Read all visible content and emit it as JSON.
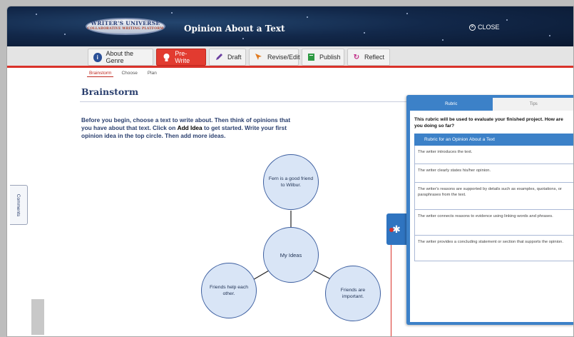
{
  "header": {
    "logo_text": "WRITER'S UNIVERSE",
    "logo_subtext": "COLLABORATIVE WRITING PLATFORM",
    "title": "Opinion About a Text",
    "close_label": "CLOSE"
  },
  "stages": [
    {
      "label": "About the Genre",
      "icon": "info-icon"
    },
    {
      "label": "Pre-Write",
      "icon": "lightbulb-icon"
    },
    {
      "label": "Draft",
      "icon": "pencil-icon"
    },
    {
      "label": "Revise/Edit",
      "icon": "cursor-icon"
    },
    {
      "label": "Publish",
      "icon": "book-icon"
    },
    {
      "label": "Reflect",
      "icon": "refresh-icon"
    }
  ],
  "subtabs": [
    "Brainstorm",
    "Choose",
    "Plan"
  ],
  "main": {
    "heading": "Brainstorm",
    "instructions_part1": "Before you begin, choose a text to write about. Then think of opinions that you have about that text. Click on ",
    "instructions_bold": "Add Idea",
    "instructions_part2": " to get started. Write your first opinion idea in the top circle. Then add more ideas."
  },
  "diagram": {
    "center": "My Ideas",
    "top": "Fern is a good friend to Wilbur.",
    "left": "Friends help each other.",
    "right": "Friends are important."
  },
  "comments_label": "Comments",
  "rubric_panel": {
    "tabs": [
      "Rubric",
      "Tips"
    ],
    "intro": "This rubric will be used to evaluate your finished project. How are you doing so far?",
    "header": "Rubric for an Opinion About a Text",
    "items": [
      "The writer introduces the text.",
      "The writer clearly states his/her opinion.",
      "The writer's reasons are supported by details such as examples, quotations, or paraphrases from the text.",
      "The writer connects reasons to evidence using linking words and phrases.",
      "The writer provides a concluding statement or section that supports the opinion."
    ]
  },
  "colors": {
    "accent_red": "#e23b30",
    "panel_blue": "#3c81c8",
    "heading_navy": "#2a3f6e"
  }
}
